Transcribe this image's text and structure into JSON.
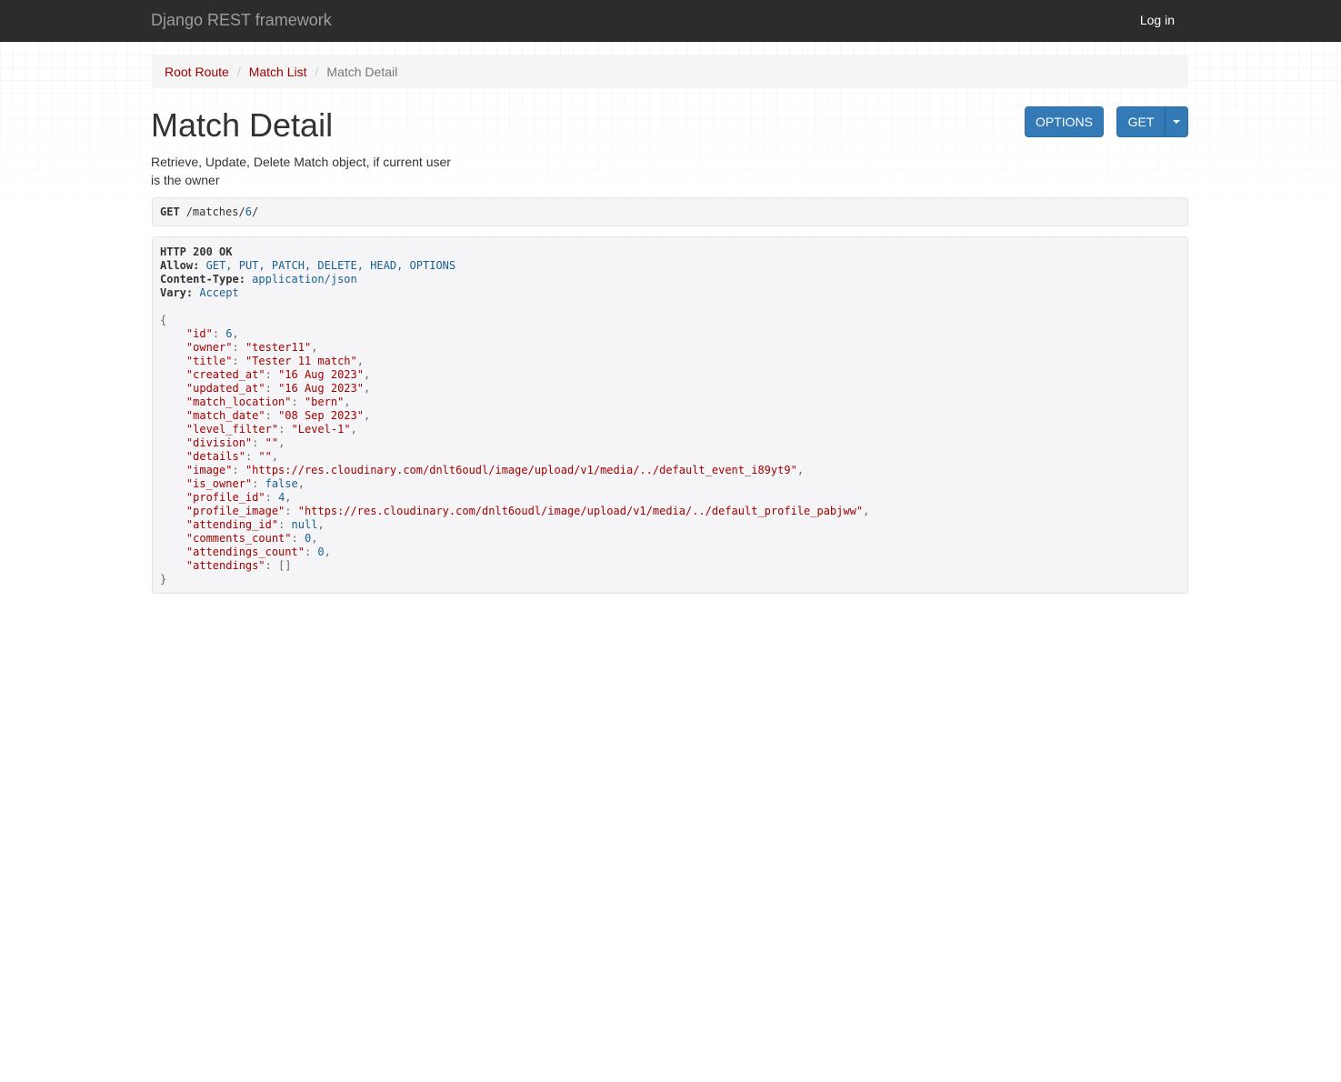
{
  "navbar": {
    "brand": "Django REST framework",
    "login": "Log in"
  },
  "breadcrumb": {
    "items": [
      "Root Route",
      "Match List"
    ],
    "active": "Match Detail",
    "separator": "/"
  },
  "page": {
    "title": "Match Detail",
    "description": "Retrieve, Update, Delete Match object, if current user is the owner"
  },
  "buttons": {
    "options": "OPTIONS",
    "get": "GET"
  },
  "request": {
    "method": "GET",
    "path_prefix": "/matches/",
    "path_id": "6",
    "path_suffix": "/"
  },
  "response": {
    "status": "HTTP 200 OK",
    "headers": [
      {
        "key": "Allow:",
        "value": "GET, PUT, PATCH, DELETE, HEAD, OPTIONS"
      },
      {
        "key": "Content-Type:",
        "value": "application/json"
      },
      {
        "key": "Vary:",
        "value": "Accept"
      }
    ],
    "body": [
      {
        "key": "\"id\"",
        "value": "6",
        "kind": "lit"
      },
      {
        "key": "\"owner\"",
        "value": "\"tester11\"",
        "kind": "str"
      },
      {
        "key": "\"title\"",
        "value": "\"Tester 11 match\"",
        "kind": "str"
      },
      {
        "key": "\"created_at\"",
        "value": "\"16 Aug 2023\"",
        "kind": "str"
      },
      {
        "key": "\"updated_at\"",
        "value": "\"16 Aug 2023\"",
        "kind": "str"
      },
      {
        "key": "\"match_location\"",
        "value": "\"bern\"",
        "kind": "str"
      },
      {
        "key": "\"match_date\"",
        "value": "\"08 Sep 2023\"",
        "kind": "str"
      },
      {
        "key": "\"level_filter\"",
        "value": "\"Level-1\"",
        "kind": "str"
      },
      {
        "key": "\"division\"",
        "value": "\"\"",
        "kind": "str"
      },
      {
        "key": "\"details\"",
        "value": "\"\"",
        "kind": "str"
      },
      {
        "key": "\"image\"",
        "value": "\"https://res.cloudinary.com/dnlt6oudl/image/upload/v1/media/../default_event_i89yt9\"",
        "kind": "str"
      },
      {
        "key": "\"is_owner\"",
        "value": "false",
        "kind": "typ"
      },
      {
        "key": "\"profile_id\"",
        "value": "4",
        "kind": "lit"
      },
      {
        "key": "\"profile_image\"",
        "value": "\"https://res.cloudinary.com/dnlt6oudl/image/upload/v1/media/../default_profile_pabjww\"",
        "kind": "str"
      },
      {
        "key": "\"attending_id\"",
        "value": "null",
        "kind": "typ"
      },
      {
        "key": "\"comments_count\"",
        "value": "0",
        "kind": "lit"
      },
      {
        "key": "\"attendings_count\"",
        "value": "0",
        "kind": "lit"
      },
      {
        "key": "\"attendings\"",
        "value": "[]",
        "kind": "pun"
      }
    ]
  }
}
